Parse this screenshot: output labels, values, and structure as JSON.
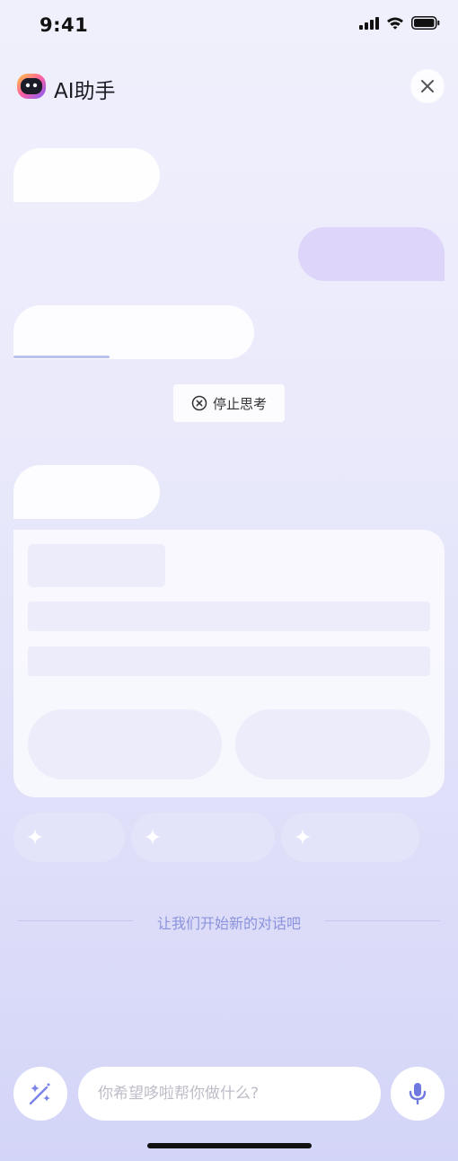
{
  "status_bar": {
    "time": "9:41",
    "icons": [
      "signal-icon",
      "wifi-icon",
      "battery-icon"
    ]
  },
  "header": {
    "title": "AI助手",
    "logo_icon": "robot-face-logo",
    "close_icon": "close-icon"
  },
  "chat": {
    "thinking_progress": 0.4,
    "stop_button_label": "停止思考",
    "stop_icon": "circle-x-icon"
  },
  "suggestion_chips": [
    {
      "icon": "sparkle-icon"
    },
    {
      "icon": "sparkle-icon"
    },
    {
      "icon": "sparkle-icon"
    }
  ],
  "divider": {
    "text": "让我们开始新的对话吧"
  },
  "input_bar": {
    "placeholder": "你希望哆啦帮你做什么?",
    "value": "",
    "magic_icon": "magic-wand-icon",
    "mic_icon": "microphone-icon"
  },
  "colors": {
    "accent": "#7a83e6",
    "user_bubble": "#ddd5fa",
    "divider_text": "#8b93dc",
    "chip_bg": "#e3e3f9"
  }
}
